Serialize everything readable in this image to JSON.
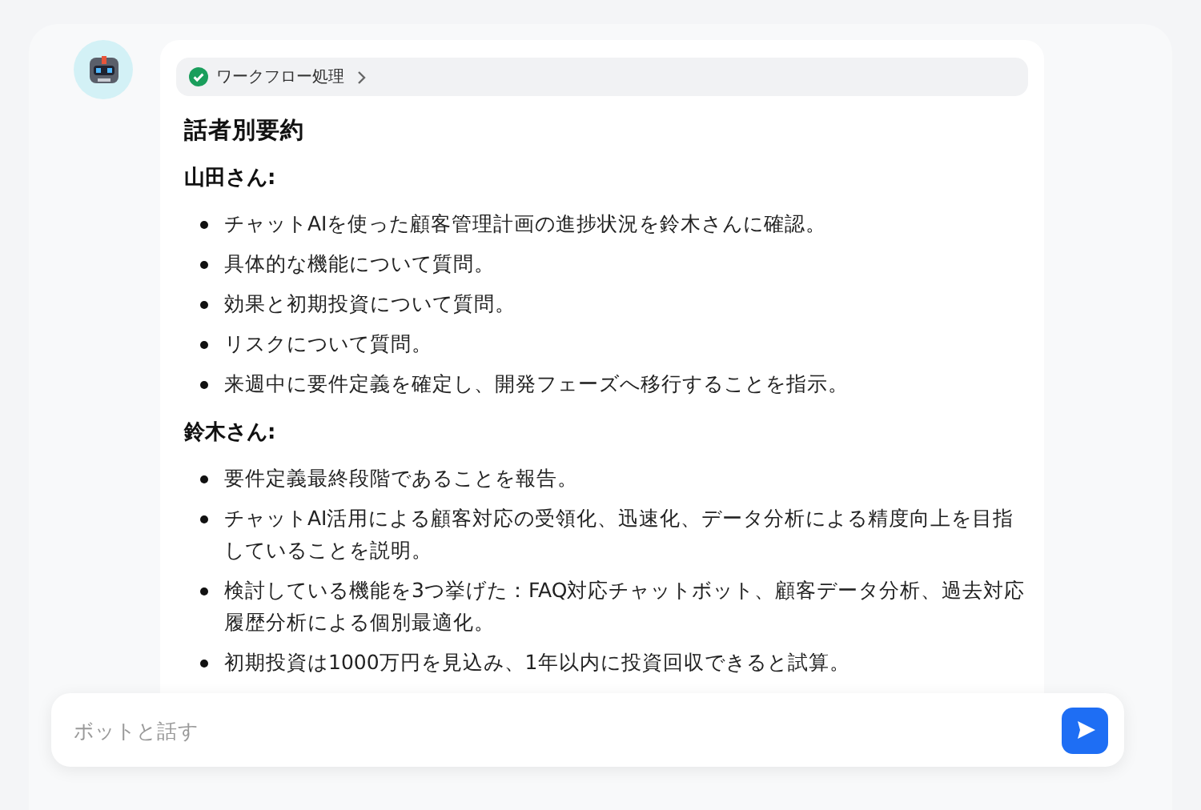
{
  "message": {
    "workflow": {
      "label": "ワークフロー処理",
      "done": true
    },
    "title": "話者別要約",
    "sections": [
      {
        "speaker": "山田さん:",
        "items": [
          "チャットAIを使った顧客管理計画の進捗状況を鈴木さんに確認。",
          "具体的な機能について質問。",
          "効果と初期投資について質問。",
          "リスクについて質問。",
          "来週中に要件定義を確定し、開発フェーズへ移行することを指示。"
        ]
      },
      {
        "speaker": "鈴木さん:",
        "items": [
          "要件定義最終段階であることを報告。",
          "チャットAI活用による顧客対応の受領化、迅速化、データ分析による精度向上を目指していることを説明。",
          "検討している機能を3つ挙げた：FAQ対応チャットボット、顧客データ分析、過去対応履歴分析による個別最適化。",
          "初期投資は1000万円を見込み、1年以内に投資回収できると試算。"
        ]
      }
    ]
  },
  "input": {
    "placeholder": "ボットと話す"
  }
}
